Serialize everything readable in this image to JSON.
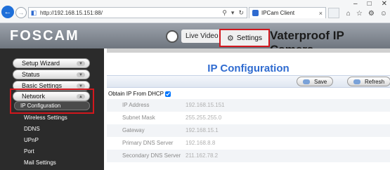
{
  "browser": {
    "address_url": "http://192.168.15.151:88/",
    "tab_title": "IPCam Client"
  },
  "header": {
    "logo_text": "FOSCAM",
    "live_video_label": "Live Video",
    "settings_label": "Settings",
    "tagline": "Vaterproof IP Camera"
  },
  "sidebar": {
    "items": [
      {
        "label": "Setup Wizard"
      },
      {
        "label": "Status"
      },
      {
        "label": "Basic Settings"
      },
      {
        "label": "Network"
      }
    ],
    "network_sub": [
      {
        "label": "IP Configuration"
      },
      {
        "label": "Wireless Settings"
      },
      {
        "label": "DDNS"
      },
      {
        "label": "UPnP"
      },
      {
        "label": "Port"
      },
      {
        "label": "Mail Settings"
      }
    ]
  },
  "main": {
    "title": "IP Configuration",
    "save_label": "Save",
    "refresh_label": "Refresh",
    "dhcp_label": "Obtain IP From DHCP",
    "fields": [
      {
        "label": "IP Address",
        "value": "192.168.15.151"
      },
      {
        "label": "Subnet Mask",
        "value": "255.255.255.0"
      },
      {
        "label": "Gateway",
        "value": "192.168.15.1"
      },
      {
        "label": "Primary DNS Server",
        "value": "192.168.8.8"
      },
      {
        "label": "Secondary DNS Server",
        "value": "211.162.78.2"
      }
    ]
  },
  "colors": {
    "accent_blue": "#2f6bd0",
    "highlight_red": "#d2171d",
    "sidebar_bg": "#2b2b2b"
  }
}
